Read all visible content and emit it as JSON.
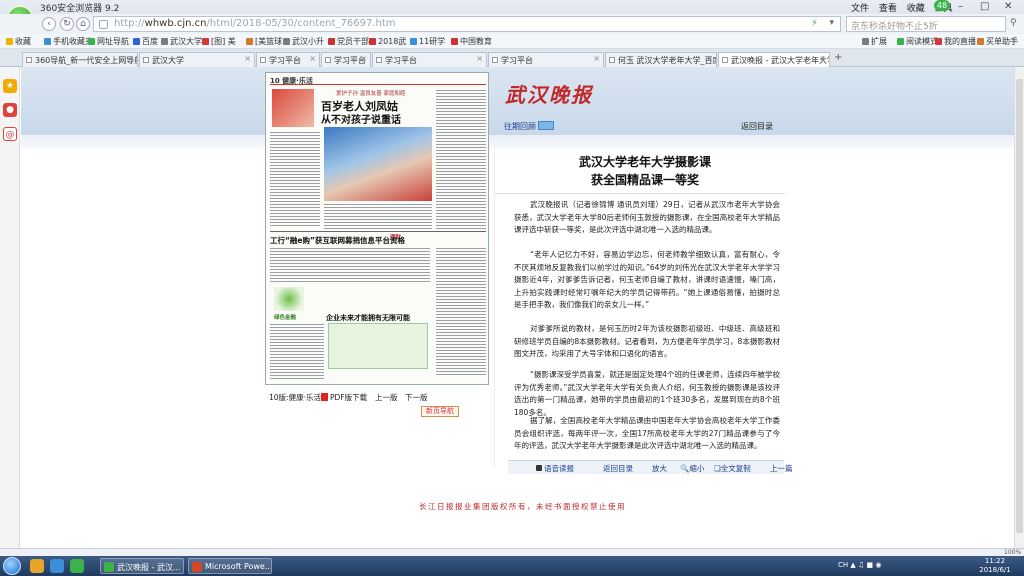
{
  "browser": {
    "title": "360安全浏览器 9.2",
    "menus": [
      "文件",
      "查看",
      "收藏",
      "工具"
    ],
    "badge": "48",
    "url_prefix": "http://",
    "url_host": "whwb.cjn.cn",
    "url_path": "/html/2018-05/30/content_76697.htm",
    "search_placeholder": "京东秒杀好物不止5折",
    "logo_letter": "e"
  },
  "bookmarks": [
    {
      "label": "收藏",
      "color": "#f0b400"
    },
    {
      "label": "手机收藏夹",
      "color": "#3c8fd6"
    },
    {
      "label": "网址导航",
      "color": "#3cb34a"
    },
    {
      "label": "百度",
      "color": "#2d63d8"
    },
    {
      "label": "武汉大学",
      "color": "#7d7d7d"
    },
    {
      "label": "[图] 美",
      "color": "#d03a3a"
    },
    {
      "label": "[美篮球",
      "color": "#d07a2a"
    },
    {
      "label": "武汉小升",
      "color": "#7d7d7d"
    },
    {
      "label": "党员干部",
      "color": "#c33"
    },
    {
      "label": "2018武",
      "color": "#c33"
    },
    {
      "label": "11研学",
      "color": "#3c8fd6"
    },
    {
      "label": "中国教育",
      "color": "#c33"
    }
  ],
  "bookmarks_right": [
    {
      "label": "扩展",
      "color": "#7d7d7d"
    },
    {
      "label": "阅读模式",
      "color": "#3cb34a"
    },
    {
      "label": "我的直播",
      "color": "#d03a3a"
    },
    {
      "label": "买单助手",
      "color": "#d07a2a"
    }
  ],
  "tabs": [
    {
      "label": "360导航_新一代安全上网导航",
      "active": false
    },
    {
      "label": "武汉大学",
      "active": false
    },
    {
      "label": "学习平台",
      "active": false
    },
    {
      "label": "学习平台",
      "active": false
    },
    {
      "label": "学习平台",
      "active": false
    },
    {
      "label": "学习平台",
      "active": false
    },
    {
      "label": "何玉 武汉大学老年大学_百度",
      "active": false
    },
    {
      "label": "武汉晚报 - 武汉大学老年大学",
      "active": true
    }
  ],
  "newspaper": {
    "edition": "10 健康·乐活",
    "subhead": "爱护子孙 温良友善 家庭和睦",
    "headline1": "百岁老人刘凤姑",
    "headline2": "从不对孩子说重话",
    "headline3": "工行“融e购”获互联网募捐信息平台资格",
    "label_finance": "理财",
    "headline4": "企业未来才能拥有无限可能",
    "label_green": "绿色金融"
  },
  "paper_links": {
    "section": "10版:健康·乐活",
    "pdf": "PDF版下载",
    "prev": "上一版",
    "next": "下一版",
    "newspaper_nav": "新页导航"
  },
  "masthead": "武汉晚报",
  "past_issues": "往期回顾",
  "back_toc": "返回目录",
  "article": {
    "title_line1": "武汉大学老年大学摄影课",
    "title_line2": "获全国精品课一等奖",
    "paragraphs": [
      "武汉晚报讯（记者徐锦博 通讯员刘瑾）29日，记者从武汉市老年大学协会获悉，武汉大学老年大学80后老师何玉敦授的摄影课，在全国高校老年大学精品课评选中斩获一等奖，是此次评选中湖北唯一入选的精品课。",
      "“老年人记忆力不好，容易边学边忘，何老师教学细致认真，富有耐心，令不厌其烦地反复教我们以前学过的知识。”64岁的刘伟光在武汉大学老年大学学习摄影近4年，对爹爹告诉记者，何玉老师自编了教材，讲课时语速慢，嗓门高，上升拍实践课时经常叮嘱年纪大的学员记得带药。“她上课通俗易懂，拍摄时总是手把手教，我们像我们的亲女儿一样。”",
      "对爹爹所说的教材，是何玉历时2年为该校摄影初级班、中级班、高级班和研修班学员自编的8本摄影教材。记者看到，为方便老年学员学习，8本摄影教材图文并茂，均采用了大号字体和口语化的语言。",
      "“摄影课深受学员喜爱，就还是固定处理4个班的任课老师，连续四年被学校评为优秀老师。”武汉大学老年大学有关负责人介绍，何玉教授的摄影课是该校评选出的第一门精品课，她带的学员由最初的1个班30多名，发展到现在的8个班180多名。",
      "据了解，全国高校老年大学精品课由中国老年大学协会高校老年大学工作委员会组织评选，每两年评一次，全国17所高校老年大学的27门精品课参与了今年的评选，武汉大学老年大学摄影课是此次评选中湖北唯一入选的精品课。"
    ]
  },
  "article_toolbar": {
    "read": "语音读报",
    "back": "返回目录",
    "zoom_in": "放大",
    "zoom_out": "缩小",
    "copy": "全文复制",
    "prev": "上一篇"
  },
  "copyright": "长江日报报业集团版权所有，未经书面授权禁止使用",
  "taskbar": {
    "tasks": [
      {
        "label": "武汉晚报 - 武汉...",
        "color": "#3cb34a"
      },
      {
        "label": "Microsoft Powe...",
        "color": "#d24726"
      }
    ],
    "tray_lang": "CH",
    "time": "11:22",
    "date": "2018/6/1"
  },
  "status": {
    "zoom": "100%"
  }
}
